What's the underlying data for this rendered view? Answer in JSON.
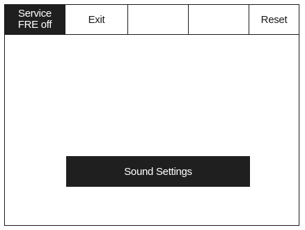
{
  "softkeys": {
    "service_line1": "Service",
    "service_line2": "FRE off",
    "exit": "Exit",
    "blank1": "",
    "blank2": "",
    "reset": "Reset"
  },
  "menu": {
    "selected_item": "Sound Settings"
  }
}
